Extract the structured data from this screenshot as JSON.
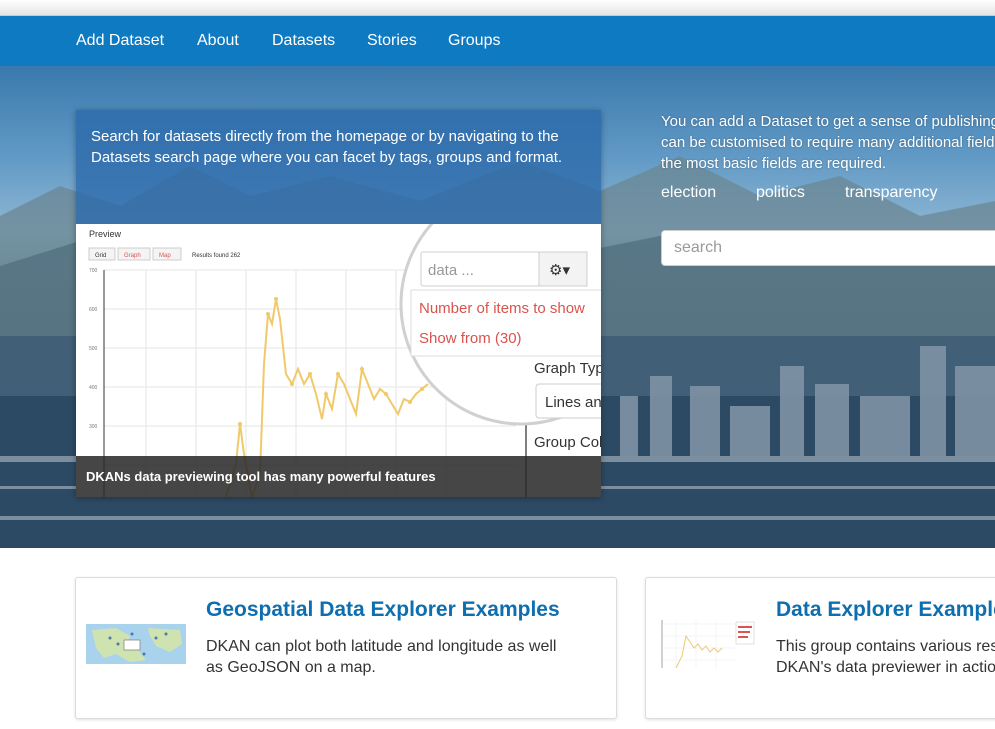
{
  "nav": {
    "items": [
      {
        "label": "Add Dataset"
      },
      {
        "label": "About"
      },
      {
        "label": "Datasets"
      },
      {
        "label": "Stories"
      },
      {
        "label": "Groups"
      }
    ]
  },
  "hero": {
    "left_text": "Search for datasets directly from the homepage or by navigating to the Datasets search page where you can facet by tags, groups and format.",
    "preview": {
      "title": "Preview",
      "buttons": [
        "Grid",
        "Graph",
        "Map"
      ],
      "results": "Results found 262",
      "y_ticks": [
        "700",
        "600",
        "500",
        "400",
        "300"
      ],
      "search_placeholder": "data ...",
      "menu_items": [
        "Number of items to show",
        "Show from (30)"
      ],
      "graph_type_label": "Graph Type",
      "lines_label": "Lines and",
      "group_label": "Group Column"
    },
    "caption": "DKANs data previewing tool has many powerful features",
    "right_lines": [
      "You can add a Dataset to get a sense of publishing data.",
      "can be customised to require many additional fields, but",
      "the most basic fields are required."
    ],
    "tags": [
      "election",
      "politics",
      "transparency"
    ],
    "search_placeholder": "search"
  },
  "cards": [
    {
      "title": "Geospatial Data Explorer Examples",
      "description": "DKAN can plot both latitude and longitude as well\nas GeoJSON on a map.",
      "thumb_icon": "map-thumbnail"
    },
    {
      "title": "Data Explorer Examples",
      "description": "This group contains various resources showing\nDKAN's data previewer in action.",
      "thumb_icon": "graph-thumbnail"
    }
  ],
  "colors": {
    "navbar": "#0d7ac2",
    "link": "#0d6fb0",
    "accent_red": "#d9534f"
  }
}
